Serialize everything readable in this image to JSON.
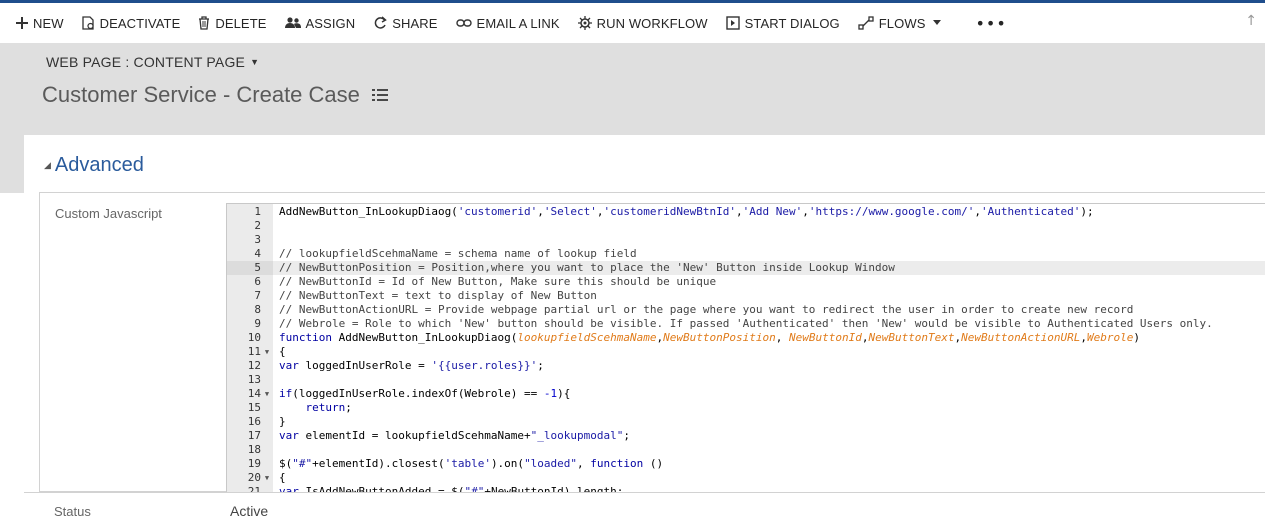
{
  "toolbar": {
    "new": "NEW",
    "deactivate": "DEACTIVATE",
    "delete": "DELETE",
    "assign": "ASSIGN",
    "share": "SHARE",
    "email_link": "EMAIL A LINK",
    "run_workflow": "RUN WORKFLOW",
    "start_dialog": "START DIALOG",
    "flows": "FLOWS",
    "more": "•••",
    "scroll_up": "↑"
  },
  "header": {
    "entity_type": "WEB PAGE : CONTENT PAGE",
    "record_title": "Customer Service - Create Case"
  },
  "section": {
    "title": "Advanced"
  },
  "form": {
    "custom_js_label": "Custom Javascript",
    "status_label": "Status",
    "status_value": "Active"
  },
  "editor": {
    "active_line": 5,
    "lines": [
      {
        "n": "1",
        "fold": false,
        "code": [
          [
            "",
            "AddNewButton_InLookupDiaog("
          ],
          [
            "str",
            "'customerid'"
          ],
          [
            "",
            ","
          ],
          [
            "str",
            "'Select'"
          ],
          [
            "",
            ","
          ],
          [
            "str",
            "'customeridNewBtnId'"
          ],
          [
            "",
            ","
          ],
          [
            "str",
            "'Add New'"
          ],
          [
            "",
            ","
          ],
          [
            "str",
            "'https://www.google.com/'"
          ],
          [
            "",
            ","
          ],
          [
            "str",
            "'Authenticated'"
          ],
          [
            "",
            ");"
          ]
        ]
      },
      {
        "n": "2",
        "fold": false,
        "code": []
      },
      {
        "n": "3",
        "fold": false,
        "code": []
      },
      {
        "n": "4",
        "fold": false,
        "code": [
          [
            "cm",
            "// lookupfieldScehmaName = schema name of lookup field"
          ]
        ]
      },
      {
        "n": "5",
        "fold": false,
        "code": [
          [
            "cm",
            "// NewButtonPosition = Position,where you want to place the 'New' Button inside Lookup Window"
          ]
        ]
      },
      {
        "n": "6",
        "fold": false,
        "code": [
          [
            "cm",
            "// NewButtonId = Id of New Button, Make sure this should be unique"
          ]
        ]
      },
      {
        "n": "7",
        "fold": false,
        "code": [
          [
            "cm",
            "// NewButtonText = text to display of New Button"
          ]
        ]
      },
      {
        "n": "8",
        "fold": false,
        "code": [
          [
            "cm",
            "// NewButtonActionURL = Provide webpage partial url or the page where you want to redirect the user in order to create new record"
          ]
        ]
      },
      {
        "n": "9",
        "fold": false,
        "code": [
          [
            "cm",
            "// Webrole = Role to which 'New' button should be visible. If passed 'Authenticated' then 'New' would be visible to Authenticated Users only."
          ]
        ]
      },
      {
        "n": "10",
        "fold": false,
        "code": [
          [
            "kw",
            "function"
          ],
          [
            "",
            " AddNewButton_InLookupDiaog("
          ],
          [
            "param",
            "lookupfieldScehmaName"
          ],
          [
            "",
            ","
          ],
          [
            "param",
            "NewButtonPosition"
          ],
          [
            "",
            ", "
          ],
          [
            "param",
            "NewButtonId"
          ],
          [
            "",
            ","
          ],
          [
            "param",
            "NewButtonText"
          ],
          [
            "",
            ","
          ],
          [
            "param",
            "NewButtonActionURL"
          ],
          [
            "",
            ","
          ],
          [
            "param",
            "Webrole"
          ],
          [
            "",
            ")"
          ]
        ]
      },
      {
        "n": "11",
        "fold": true,
        "code": [
          [
            "",
            "{"
          ]
        ]
      },
      {
        "n": "12",
        "fold": false,
        "code": [
          [
            "kw",
            "var"
          ],
          [
            "",
            " loggedInUserRole = "
          ],
          [
            "str",
            "'{{user.roles}}'"
          ],
          [
            "",
            ";"
          ]
        ]
      },
      {
        "n": "13",
        "fold": false,
        "code": []
      },
      {
        "n": "14",
        "fold": true,
        "code": [
          [
            "kw",
            "if"
          ],
          [
            "",
            "(loggedInUserRole.indexOf(Webrole) == "
          ],
          [
            "num",
            "-1"
          ],
          [
            "",
            "){"
          ]
        ]
      },
      {
        "n": "15",
        "fold": false,
        "code": [
          [
            "",
            "    "
          ],
          [
            "kw",
            "return"
          ],
          [
            "",
            ";"
          ]
        ]
      },
      {
        "n": "16",
        "fold": false,
        "code": [
          [
            "",
            "}"
          ]
        ]
      },
      {
        "n": "17",
        "fold": false,
        "code": [
          [
            "kw",
            "var"
          ],
          [
            "",
            " elementId = lookupfieldScehmaName+"
          ],
          [
            "str",
            "\"_lookupmodal\""
          ],
          [
            "",
            ";"
          ]
        ]
      },
      {
        "n": "18",
        "fold": false,
        "code": []
      },
      {
        "n": "19",
        "fold": false,
        "code": [
          [
            "",
            "$("
          ],
          [
            "str",
            "\"#\""
          ],
          [
            "",
            "+elementId).closest("
          ],
          [
            "str",
            "'table'"
          ],
          [
            "",
            ").on("
          ],
          [
            "str",
            "\"loaded\""
          ],
          [
            "",
            ", "
          ],
          [
            "kw",
            "function"
          ],
          [
            "",
            " ()"
          ]
        ]
      },
      {
        "n": "20",
        "fold": true,
        "code": [
          [
            "",
            "{"
          ]
        ]
      },
      {
        "n": "21",
        "fold": false,
        "code": [
          [
            "kw",
            "var"
          ],
          [
            "",
            " IsAddNewButtonAdded = $("
          ],
          [
            "str",
            "\"#\""
          ],
          [
            "",
            "+NewButtonId).length;"
          ]
        ]
      }
    ]
  },
  "colors": {
    "top_accent": "#1f4e8c",
    "header_band": "#dfdfdf",
    "section_title": "#2a5b9c",
    "code_string": "#1a1aa6",
    "code_keyword": "#0000a2",
    "code_param": "#e07b1a"
  },
  "icons": [
    "plus-icon",
    "document-icon",
    "trash-icon",
    "users-icon",
    "share-icon",
    "link-icon",
    "workflow-icon",
    "dialog-icon",
    "flows-icon",
    "chevron-down-icon",
    "ellipsis-icon",
    "arrow-up-icon",
    "menu-icon",
    "collapse-triangle-icon"
  ]
}
